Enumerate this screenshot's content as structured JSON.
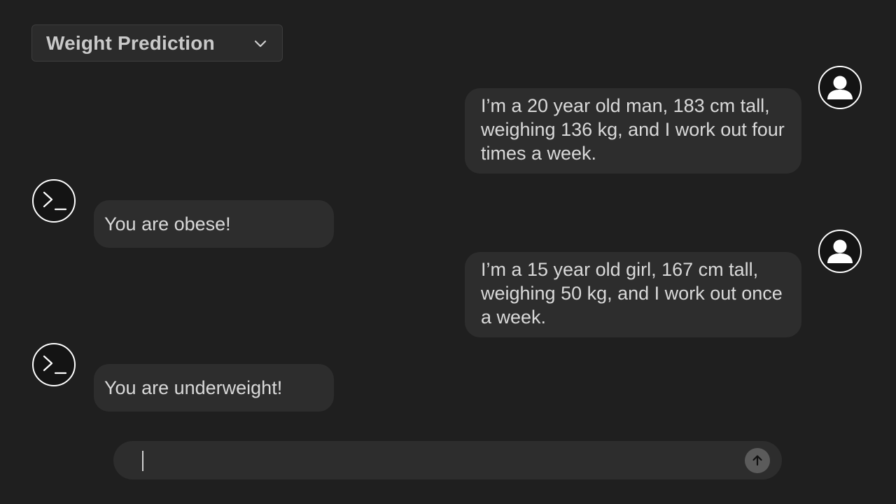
{
  "header": {
    "model_selector": {
      "selected": "Weight Prediction",
      "icon": "chevron-down-icon"
    }
  },
  "messages": [
    {
      "role": "user",
      "avatar_icon": "user-icon",
      "text": "I’m a 20 year old man, 183 cm tall, weighing 136 kg, and I work out four times a week."
    },
    {
      "role": "assistant",
      "avatar_icon": "terminal-icon",
      "text": "You are obese!"
    },
    {
      "role": "user",
      "avatar_icon": "user-icon",
      "text": "I’m a 15 year old girl, 167 cm tall, weighing 50 kg, and I work out once a week."
    },
    {
      "role": "assistant",
      "avatar_icon": "terminal-icon",
      "text": "You are underweight!"
    }
  ],
  "composer": {
    "value": "",
    "placeholder": "",
    "send_icon": "arrow-up-icon"
  },
  "colors": {
    "background": "#1f1f1f",
    "bubble": "#2d2d2d",
    "send_button": "#5b5b5b"
  }
}
